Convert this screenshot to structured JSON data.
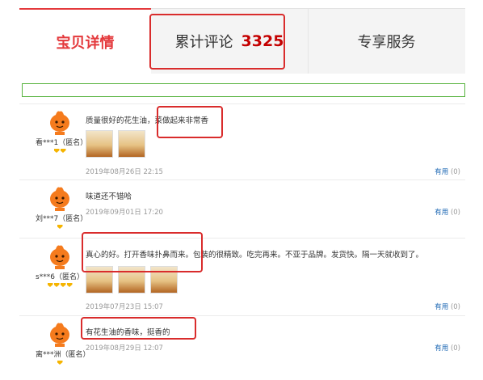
{
  "tabs": {
    "detail_label": "宝贝详情",
    "reviews_label": "累计评论",
    "reviews_count": "3325",
    "service_label": "专享服务"
  },
  "reviews": [
    {
      "user": "看***1（匿名）",
      "level": 2,
      "text": "质量很好的花生油，菜做起来非常香",
      "thumbs": 2,
      "date": "2019年08月26日 22:15",
      "useful_label": "有用",
      "useful_count": "(0)"
    },
    {
      "user": "刘***7（匿名）",
      "level": 1,
      "text": "味道还不错哈",
      "thumbs": 0,
      "date": "2019年09月01日 17:20",
      "useful_label": "有用",
      "useful_count": "(0)"
    },
    {
      "user": "s***6（匿名）",
      "level": 4,
      "text": "真心的好。打开香味扑鼻而来。包装的很精致。吃完再来。不亚于品牌。发货快。隔一天就收到了。",
      "thumbs": 3,
      "date": "2019年07月23日 15:07",
      "useful_label": "有用",
      "useful_count": "(0)"
    },
    {
      "user": "离***洲（匿名）",
      "level": 1,
      "text": "有花生油的香味，挺香的",
      "thumbs": 0,
      "date": "2019年08月29日 12:07",
      "useful_label": "有用",
      "useful_count": "(0)"
    }
  ],
  "colors": {
    "accent_red": "#e4393c",
    "count_red": "#c40000",
    "highlight": "#d92c2c",
    "link_blue": "#1a66b3",
    "green_border": "#57b33e"
  }
}
